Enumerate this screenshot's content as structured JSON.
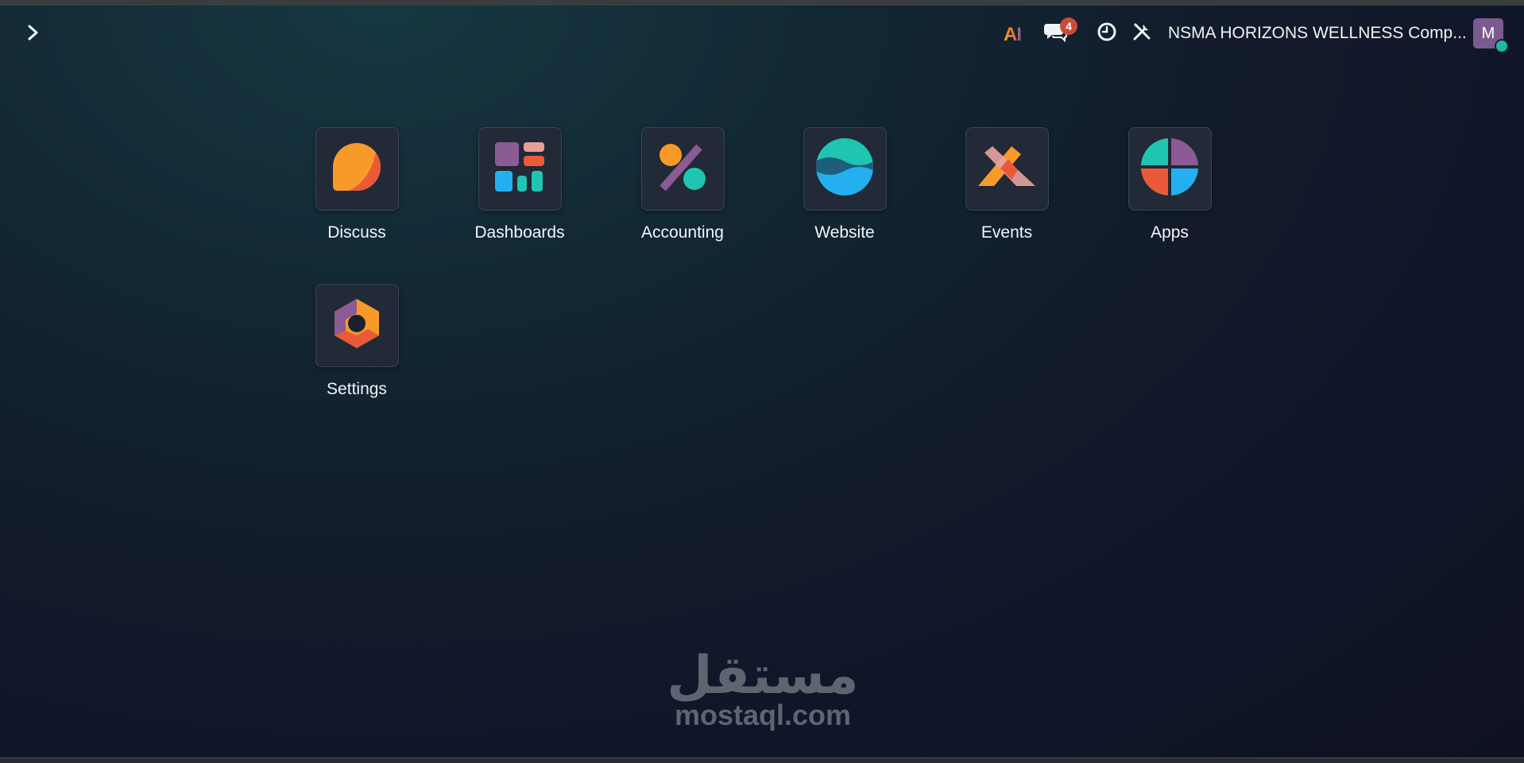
{
  "topbar": {
    "ai_label": "AI",
    "message_count": "4",
    "company_name": "NSMA HORIZONS WELLNESS Comp...",
    "avatar_initial": "M"
  },
  "apps": [
    {
      "id": "discuss",
      "label": "Discuss"
    },
    {
      "id": "dashboards",
      "label": "Dashboards"
    },
    {
      "id": "accounting",
      "label": "Accounting"
    },
    {
      "id": "website",
      "label": "Website"
    },
    {
      "id": "events",
      "label": "Events"
    },
    {
      "id": "apps",
      "label": "Apps"
    },
    {
      "id": "settings",
      "label": "Settings"
    }
  ],
  "watermark": {
    "arabic": "مستقل",
    "latin": "mostaql.com"
  },
  "colors": {
    "badge": "#c84d35",
    "avatar": "#7b5b8f",
    "status_online": "#1fb89a"
  }
}
